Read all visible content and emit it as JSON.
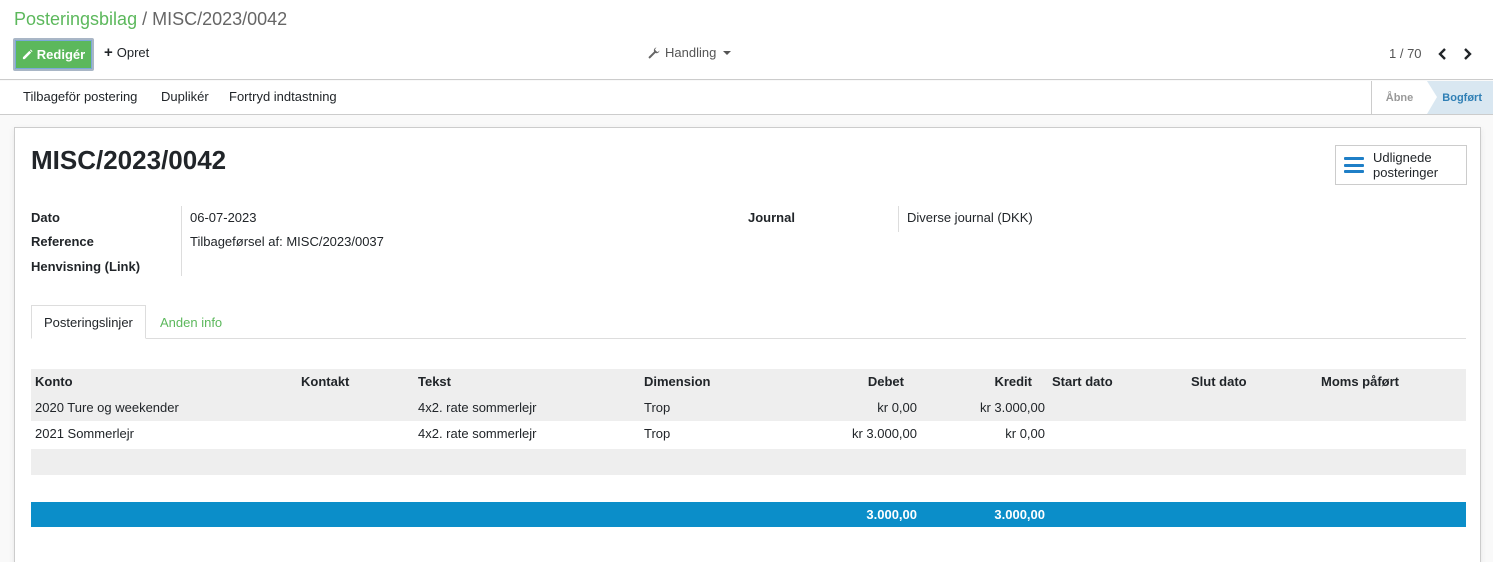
{
  "breadcrumb": {
    "parent": "Posteringsbilag",
    "separator": "/",
    "current": "MISC/2023/0042"
  },
  "toolbar": {
    "edit_label": "Redigér",
    "create_label": "Opret",
    "action_label": "Handling"
  },
  "pager": {
    "value": "1 / 70"
  },
  "statusbar": {
    "buttons": [
      "Tilbageför postering",
      "Duplikér",
      "Fortryd indtastning"
    ],
    "stages": [
      "Åbne",
      "Bogført"
    ],
    "active_stage": "Bogført"
  },
  "record": {
    "name": "MISC/2023/0042"
  },
  "smart_button": {
    "line1": "Udlignede",
    "line2": "posteringer"
  },
  "fields": {
    "date_label": "Dato",
    "date_value": "06-07-2023",
    "ref_label": "Reference",
    "ref_value": "Tilbageførsel af: MISC/2023/0037",
    "link_label": "Henvisning (Link)",
    "journal_label": "Journal",
    "journal_value": "Diverse journal (DKK)"
  },
  "tabs": [
    "Posteringslinjer",
    "Anden info"
  ],
  "table": {
    "columns": [
      "Konto",
      "Kontakt",
      "Tekst",
      "Dimension",
      "Debet",
      "Kredit",
      "Start dato",
      "Slut dato",
      "Moms påført"
    ],
    "rows": [
      [
        "2020 Ture og weekender",
        "",
        "4x2. rate sommerlejr",
        "Trop",
        "kr 0,00",
        "kr 3.000,00",
        "",
        "",
        ""
      ],
      [
        "2021 Sommerlejr",
        "",
        "4x2. rate sommerlejr",
        "Trop",
        "kr 3.000,00",
        "kr 0,00",
        "",
        "",
        ""
      ]
    ],
    "totals": {
      "debit": "3.000,00",
      "credit": "3.000,00"
    }
  },
  "colors": {
    "brand_green": "#5cb85c",
    "totals_blue": "#0b8ec9",
    "icon_blue": "#1f7fc7"
  },
  "icons": [
    "pencil-icon",
    "plus-icon",
    "wrench-icon",
    "chevron-left-icon",
    "chevron-right-icon",
    "list-icon"
  ]
}
